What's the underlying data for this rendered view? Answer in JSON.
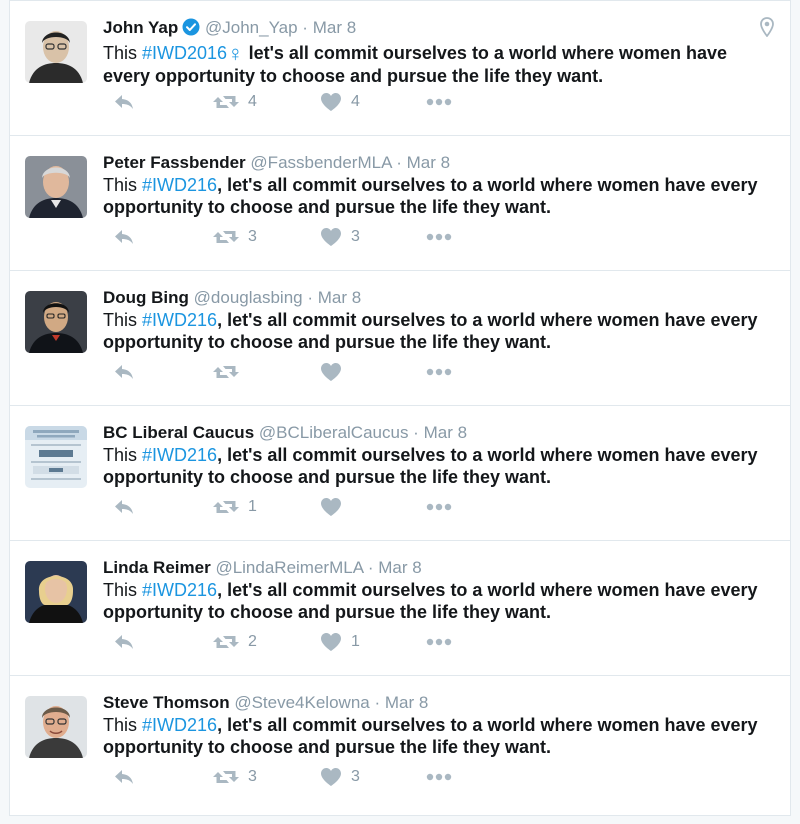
{
  "colors": {
    "accent": "#1b95e0",
    "muted": "#8899a6",
    "text": "#14171a",
    "border": "#e1e8ed"
  },
  "tweets": [
    {
      "name": "John Yap",
      "verified": true,
      "handle": "@John_Yap",
      "separator": "·",
      "time": "Mar 8",
      "text_prefix": "This ",
      "hashtag": "#IWD2016",
      "emoji": "♀",
      "text_body": " let's all commit ourselves to a world where women have every opportunity to choose and pursue the life they want.",
      "retweets": "4",
      "likes": "4",
      "icon": "geo-pin-icon"
    },
    {
      "name": "Peter Fassbender",
      "verified": false,
      "handle": "@FassbenderMLA",
      "separator": "·",
      "time": "Mar 8",
      "text_prefix": "This ",
      "hashtag": "#IWD216",
      "text_body": ", let's all commit ourselves to a world where women have every opportunity to choose and pursue the life they want.",
      "retweets": "3",
      "likes": "3"
    },
    {
      "name": "Doug Bing",
      "verified": false,
      "handle": "@douglasbing",
      "separator": "·",
      "time": "Mar 8",
      "text_prefix": "This ",
      "hashtag": "#IWD216",
      "text_body": ", let's all commit ourselves to a world where women have every opportunity to choose and pursue the life they want.",
      "retweets": "",
      "likes": ""
    },
    {
      "name": "BC Liberal Caucus",
      "verified": false,
      "handle": "@BCLiberalCaucus",
      "separator": "·",
      "time": "Mar 8",
      "text_prefix": "This ",
      "hashtag": "#IWD216",
      "text_body": ", let's all commit ourselves to a world where women have every opportunity to choose and pursue the life they want.",
      "retweets": "1",
      "likes": ""
    },
    {
      "name": "Linda Reimer",
      "verified": false,
      "handle": "@LindaReimerMLA",
      "separator": "·",
      "time": "Mar 8",
      "text_prefix": "This ",
      "hashtag": "#IWD216",
      "text_body": ", let's all commit ourselves to a world where women have every opportunity to choose and pursue the life they want.",
      "retweets": "2",
      "likes": "1"
    },
    {
      "name": "Steve Thomson",
      "verified": false,
      "handle": "@Steve4Kelowna",
      "separator": "·",
      "time": "Mar 8",
      "text_prefix": "This ",
      "hashtag": "#IWD216",
      "text_body": ", let's all commit ourselves to a world where women have every opportunity to choose and pursue the life they want.",
      "retweets": "3",
      "likes": "3"
    }
  ]
}
